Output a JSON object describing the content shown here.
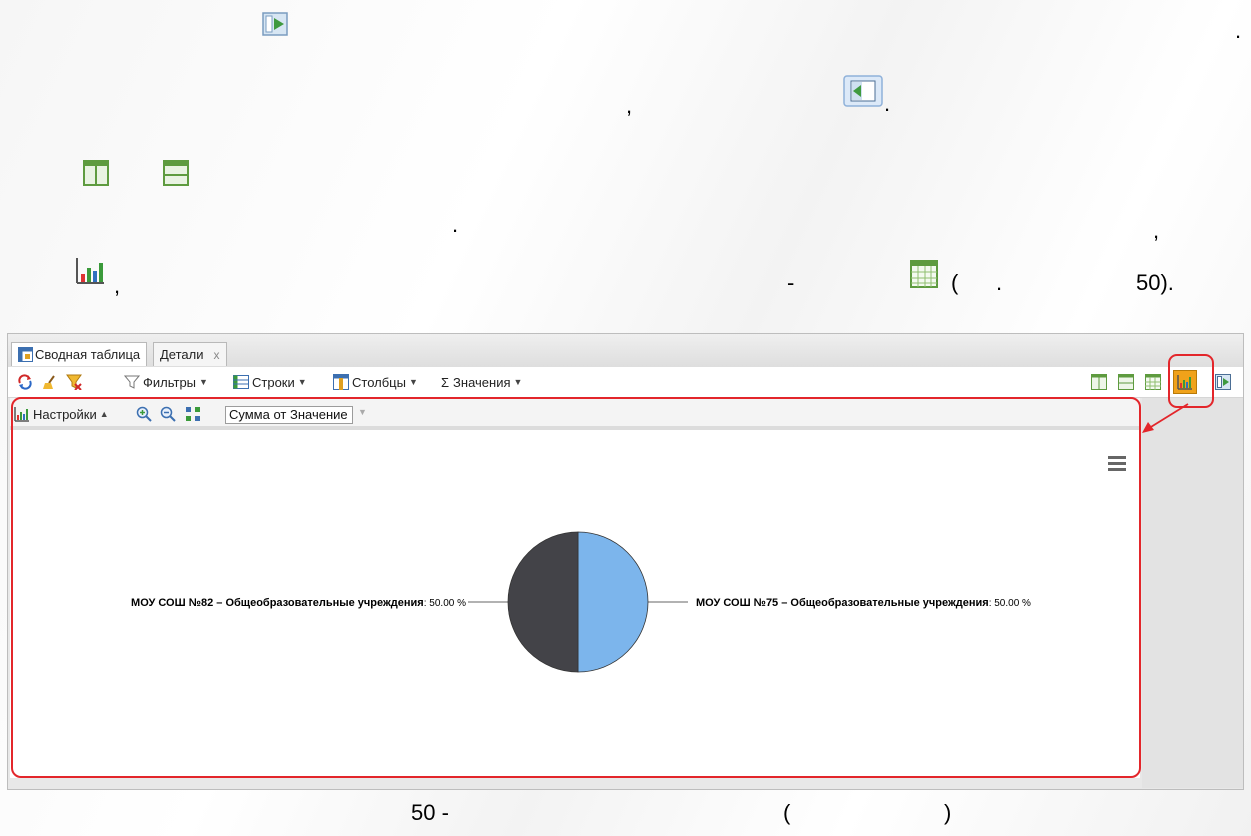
{
  "doc": {
    "line1_dot": ".",
    "line2_comma": ",",
    "line2_dot": ".",
    "line4_dot": ".",
    "line4_comma": ",",
    "line5_comma": ",",
    "line5_dash": "-",
    "line5_paren_open": "(",
    "line5_dot": ".",
    "line5_ref": "50).",
    "caption_num": "50 -",
    "caption_paren_open": "(",
    "caption_paren_close": ")"
  },
  "app": {
    "tabs": [
      {
        "label": "Сводная таблица",
        "active": true
      },
      {
        "label": "Детали",
        "active": false,
        "close": "x"
      }
    ],
    "toolbar": {
      "filters": "Фильтры",
      "rows": "Строки",
      "columns": "Столбцы",
      "values_sigma": "Σ",
      "values": "Значения"
    },
    "settings": {
      "label": "Настройки",
      "measure_select": "Сумма от Значение"
    }
  },
  "chart_data": {
    "type": "pie",
    "categories": [
      "МОУ СОШ №82 – Общеобразовательные учреждения",
      "МОУ СОШ №75 – Общеобразовательные учреждения"
    ],
    "values": [
      50.0,
      50.0
    ],
    "value_labels": [
      ": 50.00 %",
      ": 50.00 %"
    ],
    "colors": [
      "#434348",
      "#7cb5ec"
    ],
    "menu_icon": "hamburger-menu-icon"
  },
  "colors": {
    "annotation": "#e3262b",
    "accent_orange": "#f0a21a"
  }
}
